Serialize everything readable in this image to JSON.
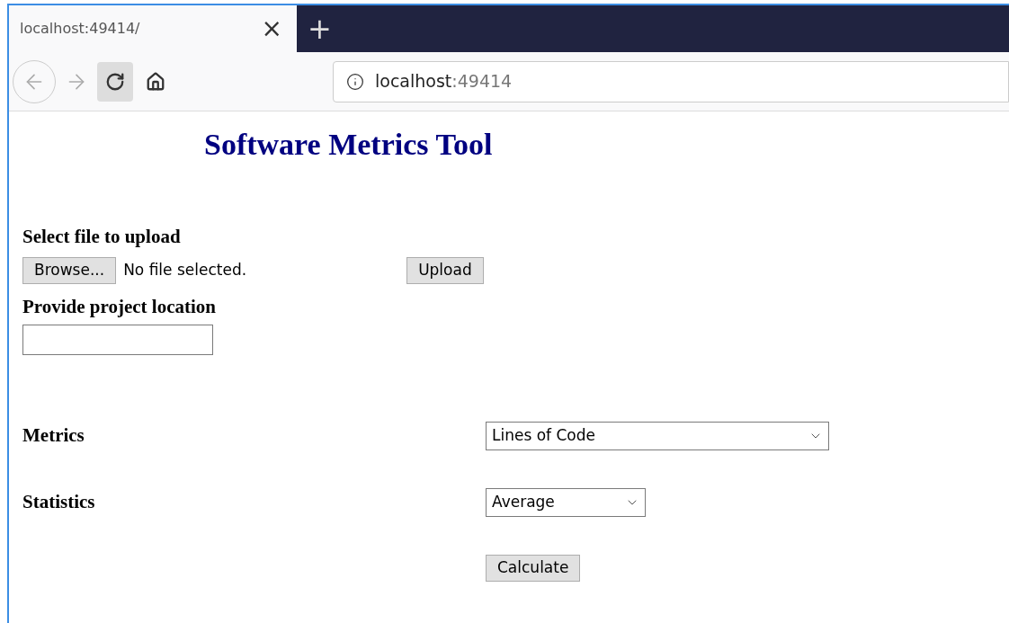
{
  "browser": {
    "tab": {
      "title": "localhost:49414/",
      "close": "×",
      "selected": true
    },
    "new_tab": "+",
    "address": {
      "host": "localhost",
      "port": ":49414"
    }
  },
  "page": {
    "title": "Software Metrics Tool",
    "upload": {
      "label": "Select file to upload",
      "browse": "Browse...",
      "file_status": "No file selected.",
      "button": "Upload"
    },
    "location": {
      "label": "Provide project location"
    },
    "metrics": {
      "label": "Metrics",
      "value": "Lines of Code"
    },
    "statistics": {
      "label": "Statistics",
      "value": "Average"
    },
    "calculate": "Calculate"
  }
}
